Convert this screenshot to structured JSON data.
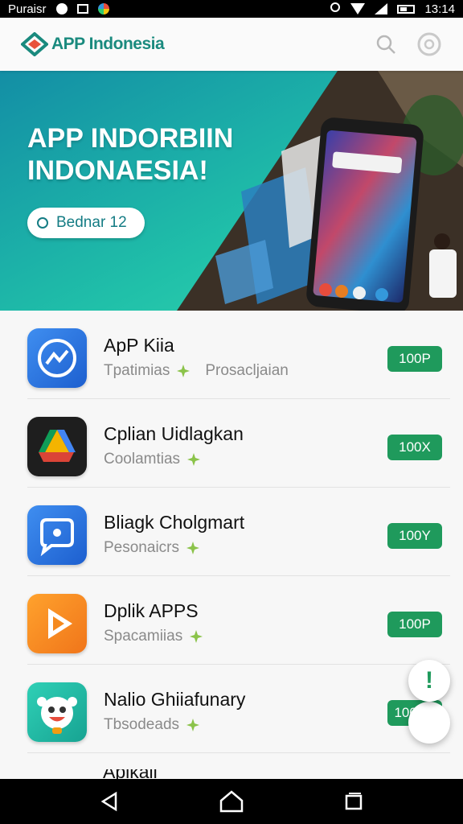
{
  "status_bar": {
    "carrier": "Puraisr",
    "time": "13:14"
  },
  "header": {
    "title": "APP Indonesia",
    "brand_color": "#1a8a7e",
    "search_icon": "search-icon",
    "profile_icon": "profile-icon"
  },
  "banner": {
    "title": "APP INDORBIIN\nINDONAESIA!",
    "pill_label": "Bednar 12"
  },
  "apps": [
    {
      "name": "ApP Kiia",
      "subtitle": "Tpatimias",
      "subtitle2": "Prosacljaian",
      "price": "100P",
      "icon": "messenger-icon",
      "color": "#2a7de1"
    },
    {
      "name": "Cplian Uidlagkan",
      "subtitle": "Coolamtias",
      "subtitle2": "",
      "price": "100X",
      "icon": "drive-triangle-icon",
      "color": "#1e1e1e"
    },
    {
      "name": "Bliagk Cholgmart",
      "subtitle": "Pesonaicrs",
      "subtitle2": "",
      "price": "100Y",
      "icon": "chat-bubble-icon",
      "color": "#2a7de1"
    },
    {
      "name": "Dplik APPS",
      "subtitle": "Spacamiias",
      "subtitle2": "",
      "price": "100P",
      "icon": "play-icon",
      "color": "#f58a1f"
    },
    {
      "name": "Nalio Ghiiafunary",
      "subtitle": "Tbsodeads",
      "subtitle2": "",
      "price": "100VS",
      "icon": "cartoon-face-icon",
      "color": "#1fb5a3"
    }
  ],
  "partial_row_text": "Aplkaii",
  "fab": {
    "label": "!"
  },
  "colors": {
    "price_bg": "#1f9a5c",
    "banner_teal": "#1fbfa9"
  }
}
